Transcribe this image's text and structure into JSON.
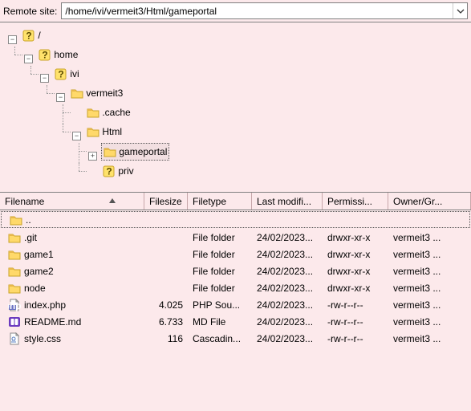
{
  "remote_label": "Remote site:",
  "path": "/home/ivi/vermeit3/Html/gameportal",
  "tree": {
    "root": "/",
    "home": "home",
    "ivi": "ivi",
    "vermeit3": "vermeit3",
    "cache": ".cache",
    "html": "Html",
    "gameportal": "gameportal",
    "priv": "priv"
  },
  "columns": {
    "name": "Filename",
    "size": "Filesize",
    "type": "Filetype",
    "mod": "Last modifi...",
    "perm": "Permissi...",
    "own": "Owner/Gr..."
  },
  "rows": [
    {
      "name": "..",
      "icon": "folder",
      "size": "",
      "type": "",
      "mod": "",
      "perm": "",
      "own": ""
    },
    {
      "name": ".git",
      "icon": "folder",
      "size": "",
      "type": "File folder",
      "mod": "24/02/2023...",
      "perm": "drwxr-xr-x",
      "own": "vermeit3 ..."
    },
    {
      "name": "game1",
      "icon": "folder",
      "size": "",
      "type": "File folder",
      "mod": "24/02/2023...",
      "perm": "drwxr-xr-x",
      "own": "vermeit3 ..."
    },
    {
      "name": "game2",
      "icon": "folder",
      "size": "",
      "type": "File folder",
      "mod": "24/02/2023...",
      "perm": "drwxr-xr-x",
      "own": "vermeit3 ..."
    },
    {
      "name": "node",
      "icon": "folder",
      "size": "",
      "type": "File folder",
      "mod": "24/02/2023...",
      "perm": "drwxr-xr-x",
      "own": "vermeit3 ..."
    },
    {
      "name": "index.php",
      "icon": "php",
      "size": "4.025",
      "type": "PHP Sou...",
      "mod": "24/02/2023...",
      "perm": "-rw-r--r--",
      "own": "vermeit3 ..."
    },
    {
      "name": "README.md",
      "icon": "md",
      "size": "6.733",
      "type": "MD File",
      "mod": "24/02/2023...",
      "perm": "-rw-r--r--",
      "own": "vermeit3 ..."
    },
    {
      "name": "style.css",
      "icon": "css",
      "size": "116",
      "type": "Cascadin...",
      "mod": "24/02/2023...",
      "perm": "-rw-r--r--",
      "own": "vermeit3 ..."
    }
  ]
}
